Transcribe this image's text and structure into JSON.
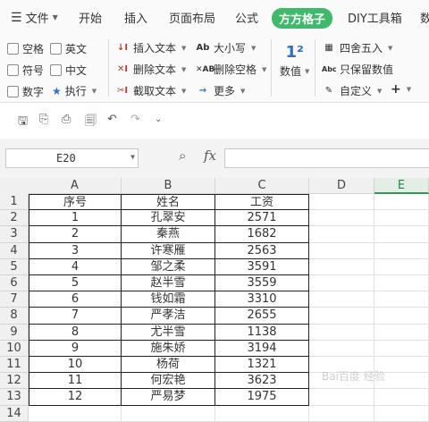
{
  "menubar": {
    "file_label": "文件",
    "tabs": [
      {
        "label": "开始",
        "active": false
      },
      {
        "label": "插入",
        "active": false
      },
      {
        "label": "页面布局",
        "active": false
      },
      {
        "label": "公式",
        "active": false
      },
      {
        "label": "方方格子",
        "active": true
      },
      {
        "label": "DIY工具箱",
        "active": false
      },
      {
        "label": "数",
        "active": false
      }
    ]
  },
  "ribbon": {
    "checkboxes": [
      "空格",
      "英文",
      "符号",
      "中文",
      "数字"
    ],
    "run_label": "执行",
    "text_tools": [
      "插入文本",
      "删除文本",
      "截取文本"
    ],
    "case_tools": [
      "大小写",
      "删除空格",
      "更多"
    ],
    "number_label": "数值",
    "round_label": "四舍五入",
    "keep_value_label": "只保留数值",
    "custom_label": "自定义"
  },
  "quickbar": {
    "icons": [
      "save-icon",
      "format-painter-icon",
      "print-icon",
      "print-preview-icon",
      "undo-icon",
      "redo-icon",
      "customize-icon"
    ]
  },
  "formula_bar": {
    "cell_ref": "E20",
    "fx_label": "fx",
    "formula_value": ""
  },
  "grid": {
    "columns": [
      "A",
      "B",
      "C",
      "D",
      "E"
    ],
    "selected_column": "E",
    "rows": [
      [
        "序号",
        "姓名",
        "工资"
      ],
      [
        "1",
        "孔翠安",
        "2571"
      ],
      [
        "2",
        "秦燕",
        "1682"
      ],
      [
        "3",
        "许寒雁",
        "2563"
      ],
      [
        "4",
        "邹之柔",
        "3591"
      ],
      [
        "5",
        "赵半雪",
        "3559"
      ],
      [
        "6",
        "钱如霜",
        "3310"
      ],
      [
        "7",
        "严孝洁",
        "2655"
      ],
      [
        "8",
        "尤半雪",
        "1138"
      ],
      [
        "9",
        "施朱娇",
        "3194"
      ],
      [
        "10",
        "杨荷",
        "1321"
      ],
      [
        "11",
        "何宏艳",
        "3623"
      ],
      [
        "12",
        "严易梦",
        "1975"
      ]
    ]
  },
  "watermark": "Bai百度 经验",
  "colors": {
    "accent": "#3dbb6b",
    "header_bg": "#f0f0f0"
  }
}
